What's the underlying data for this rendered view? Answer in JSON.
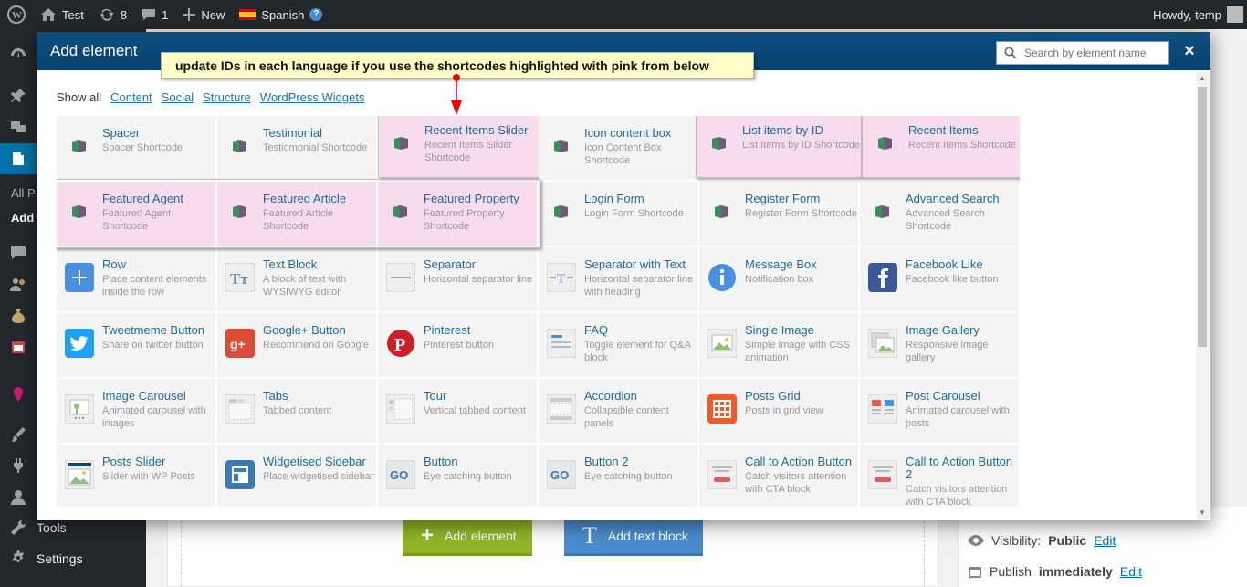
{
  "adminbar": {
    "site": "Test",
    "updates": "8",
    "comments": "1",
    "new_label": "New",
    "language": "Spanish",
    "howdy": "Howdy, temp"
  },
  "sidebar": {
    "sub_all": "All P",
    "sub_add": "Add",
    "tools": "Tools",
    "settings": "Settings"
  },
  "modal": {
    "title": "Add element",
    "search_placeholder": "Search by element name",
    "close": "×",
    "tooltip": "update IDs in each language if you use the shortcodes highlighted with pink from below",
    "filters": [
      "Show all",
      "Content",
      "Social",
      "Structure",
      "WordPress Widgets"
    ]
  },
  "elements": [
    {
      "name": "Spacer",
      "desc": "Spacer Shortcode",
      "icon": "shortcode-icon"
    },
    {
      "name": "Testimonial",
      "desc": "Testiomonial Shortcode",
      "icon": "shortcode-icon"
    },
    {
      "name": "Recent Items Slider",
      "desc": "Recent Items Slider Shortcode",
      "icon": "shortcode-icon"
    },
    {
      "name": "Icon content box",
      "desc": "Icon Content Box Shortcode",
      "icon": "shortcode-icon"
    },
    {
      "name": "List items by ID",
      "desc": "List Items by ID Shortcode",
      "icon": "shortcode-icon"
    },
    {
      "name": "Recent Items",
      "desc": "Recent Items Shortcode",
      "icon": "shortcode-icon"
    },
    {
      "name": "Featured Agent",
      "desc": "Featured Agent Shortcode",
      "icon": "shortcode-icon"
    },
    {
      "name": "Featured Article",
      "desc": "Featured Article Shortcode",
      "icon": "shortcode-icon"
    },
    {
      "name": "Featured Property",
      "desc": "Featured Property Shortcode",
      "icon": "shortcode-icon"
    },
    {
      "name": "Login Form",
      "desc": "Login Form Shortcode",
      "icon": "shortcode-icon"
    },
    {
      "name": "Register Form",
      "desc": "Register Form Shortcode",
      "icon": "shortcode-icon"
    },
    {
      "name": "Advanced Search",
      "desc": "Advanced Search Shortcode",
      "icon": "shortcode-icon"
    },
    {
      "name": "Row",
      "desc": "Place content elements inside the row",
      "icon": "plus-icon"
    },
    {
      "name": "Text Block",
      "desc": "A block of text with WYSIWYG editor",
      "icon": "text-icon"
    },
    {
      "name": "Separator",
      "desc": "Horizontal separator line",
      "icon": "separator-icon"
    },
    {
      "name": "Separator with Text",
      "desc": "Horizontal separator line with heading",
      "icon": "separator-text-icon"
    },
    {
      "name": "Message Box",
      "desc": "Notification box",
      "icon": "info-icon"
    },
    {
      "name": "Facebook Like",
      "desc": "Facebook like button",
      "icon": "facebook-icon"
    },
    {
      "name": "Tweetmeme Button",
      "desc": "Share on twitter button",
      "icon": "twitter-icon"
    },
    {
      "name": "Google+ Button",
      "desc": "Recommend on Google",
      "icon": "googleplus-icon"
    },
    {
      "name": "Pinterest",
      "desc": "Pinterest button",
      "icon": "pinterest-icon"
    },
    {
      "name": "FAQ",
      "desc": "Toggle element for Q&A block",
      "icon": "faq-icon"
    },
    {
      "name": "Single Image",
      "desc": "Simple image with CSS animation",
      "icon": "image-icon"
    },
    {
      "name": "Image Gallery",
      "desc": "Responsive image gallery",
      "icon": "gallery-icon"
    },
    {
      "name": "Image Carousel",
      "desc": "Animated carousel with images",
      "icon": "carousel-icon"
    },
    {
      "name": "Tabs",
      "desc": "Tabbed content",
      "icon": "tabs-icon"
    },
    {
      "name": "Tour",
      "desc": "Vertical tabbed content",
      "icon": "tour-icon"
    },
    {
      "name": "Accordion",
      "desc": "Collapsible content panels",
      "icon": "accordion-icon"
    },
    {
      "name": "Posts Grid",
      "desc": "Posts in grid view",
      "icon": "grid-icon"
    },
    {
      "name": "Post Carousel",
      "desc": "Animated carousel with posts",
      "icon": "post-carousel-icon"
    },
    {
      "name": "Posts Slider",
      "desc": "Slider with WP Posts",
      "icon": "slider-icon"
    },
    {
      "name": "Widgetised Sidebar",
      "desc": "Place widgetised sidebar",
      "icon": "widget-icon"
    },
    {
      "name": "Button",
      "desc": "Eye catching button",
      "icon": "go-icon"
    },
    {
      "name": "Button 2",
      "desc": "Eye catching button",
      "icon": "go-icon"
    },
    {
      "name": "Call to Action Button",
      "desc": "Catch visitors attention with CTA block",
      "icon": "cta-icon"
    },
    {
      "name": "Call to Action Button 2",
      "desc": "Catch visitors attention with CTA block",
      "icon": "cta-icon"
    }
  ],
  "background": {
    "add_element": "Add element",
    "add_text_block": "Add text block",
    "visibility_label": "Visibility:",
    "visibility_value": "Public",
    "publish_label": "Publish",
    "publish_value": "immediately",
    "edit": "Edit"
  }
}
